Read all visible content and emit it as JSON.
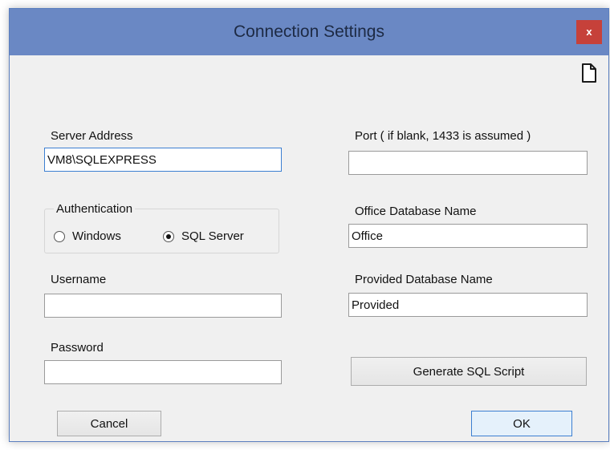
{
  "window": {
    "title": "Connection Settings",
    "close_glyph": "x"
  },
  "icons": {
    "page": "new-page-icon"
  },
  "server": {
    "label": "Server Address",
    "value": "VM8\\SQLEXPRESS"
  },
  "port": {
    "label": "Port ( if blank, 1433 is assumed )",
    "value": ""
  },
  "authentication": {
    "legend": "Authentication",
    "options": [
      {
        "label": "Windows",
        "selected": false
      },
      {
        "label": "SQL Server",
        "selected": true
      }
    ]
  },
  "office_db": {
    "label": "Office Database Name",
    "value": "Office"
  },
  "username": {
    "label": "Username",
    "value": ""
  },
  "provided_db": {
    "label": "Provided Database Name",
    "value": "Provided"
  },
  "password": {
    "label": "Password",
    "value": ""
  },
  "buttons": {
    "generate": "Generate SQL Script",
    "cancel": "Cancel",
    "ok": "OK"
  },
  "colors": {
    "titlebar": "#6a88c4",
    "close": "#c6413a",
    "focus_border": "#3c7fd1"
  }
}
